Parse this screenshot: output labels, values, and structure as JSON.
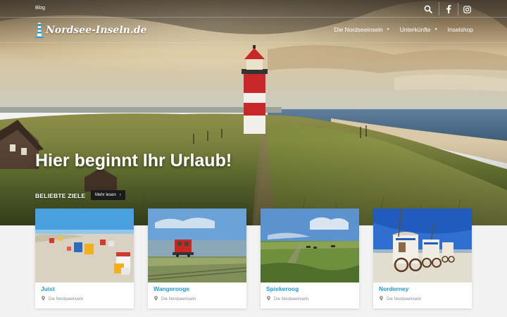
{
  "topbar": {
    "blog_label": "Blog",
    "icons": [
      "search-icon",
      "facebook-icon",
      "instagram-icon"
    ]
  },
  "brand": {
    "logo_text": "Nordsee-Inseln.de"
  },
  "nav": {
    "items": [
      {
        "label": "Die Nordseeinseln",
        "has_dropdown": true
      },
      {
        "label": "Unterkünfte",
        "has_dropdown": true
      },
      {
        "label": "Inselshop",
        "has_dropdown": false
      }
    ]
  },
  "hero": {
    "title": "Hier beginnt Ihr Urlaub!"
  },
  "popular": {
    "heading": "BELIEBTE ZIELE",
    "more_label": "Mehr lesen"
  },
  "cards": [
    {
      "title": "Juist",
      "location": "Die Nordseeinseln"
    },
    {
      "title": "Wangerooge",
      "location": "Die Nordseeinseln"
    },
    {
      "title": "Spiekeroog",
      "location": "Die Nordseeinseln"
    },
    {
      "title": "Norderney",
      "location": "Die Nordseeinseln"
    }
  ],
  "colors": {
    "accent": "#1e9cd7",
    "button_bg": "#1a1a1a",
    "page_bg": "#f2f2f2"
  }
}
